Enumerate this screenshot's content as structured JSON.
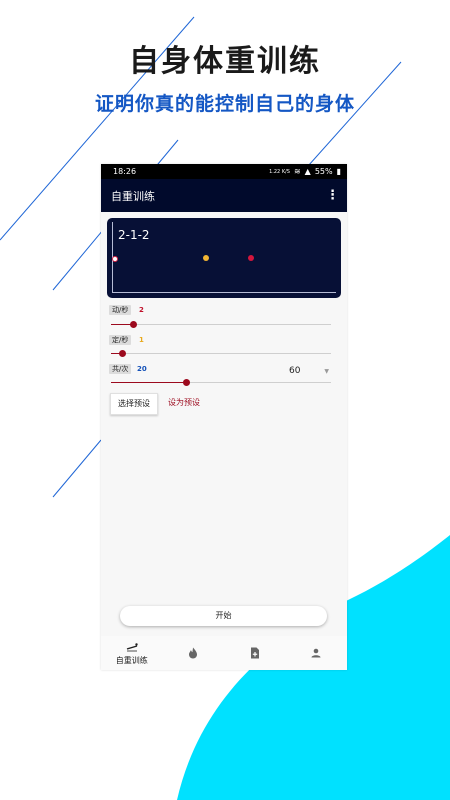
{
  "promo": {
    "title": "自身体重训练",
    "subtitle": "证明你真的能控制自己的身体"
  },
  "status_bar": {
    "time": "18:26",
    "net_speed": "1.22 K/S",
    "battery": "55%"
  },
  "app_bar": {
    "title": "自重训练",
    "menu_icon": "more-vert-icon"
  },
  "display": {
    "pattern": "2-1-2",
    "dots": [
      {
        "name": "start",
        "color": "#ffffff"
      },
      {
        "name": "hold",
        "color": "#f2b533"
      },
      {
        "name": "move",
        "color": "#d4163d"
      }
    ]
  },
  "params": [
    {
      "label": "动/秒",
      "value": "2",
      "value_color": "#c0102a",
      "level": 0.1
    },
    {
      "label": "定/秒",
      "value": "1",
      "value_color": "#e8a91c",
      "level": 0.05
    },
    {
      "label": "共/次",
      "value": "20",
      "value_color": "#1451b8",
      "level": 0.34
    }
  ],
  "reps_dropdown": {
    "selected": "60"
  },
  "buttons": {
    "select_preset": "选择预设",
    "set_preset": "设为预设",
    "start": "开始"
  },
  "bottom_nav": [
    {
      "label": "自重训练",
      "icon": "pushup-icon"
    },
    {
      "label": "",
      "icon": "fire-icon"
    },
    {
      "label": "",
      "icon": "add-document-icon"
    },
    {
      "label": "",
      "icon": "person-icon"
    }
  ],
  "colors": {
    "accent": "#9c0a1e",
    "app_bar": "#010a2c",
    "display_bg": "#071036",
    "promo_blue": "#1457c4",
    "cyan": "#00e1ff"
  }
}
